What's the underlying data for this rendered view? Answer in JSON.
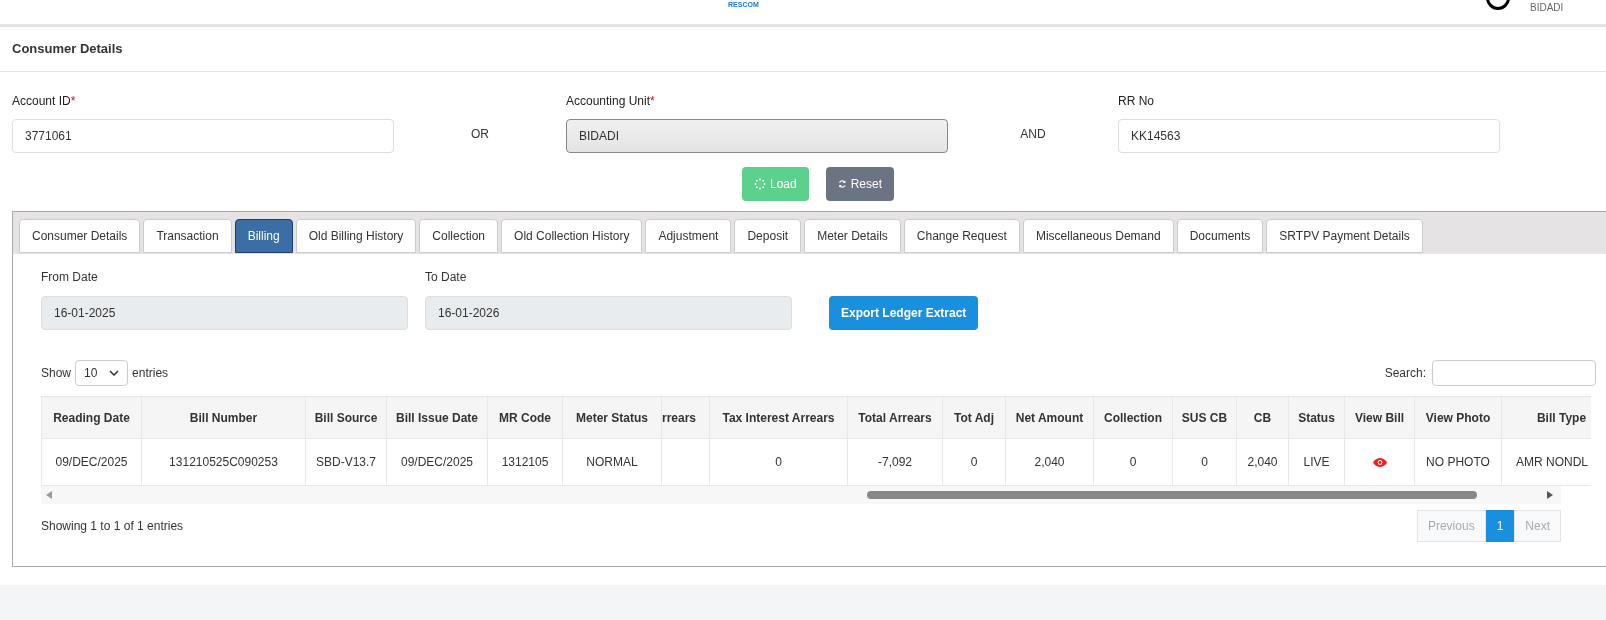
{
  "header": {
    "logo_text": "RESCOM",
    "user": "BIDADI"
  },
  "page_title": "Consumer Details",
  "form": {
    "fields": [
      {
        "label": "Account ID",
        "required_mark": "*",
        "value": "3771061",
        "disabled": false
      },
      {
        "label": "Accounting Unit",
        "required_mark": "*",
        "value": "BIDADI",
        "disabled": true
      },
      {
        "label": "RR No",
        "value": "KK14563",
        "disabled": false
      }
    ],
    "separators": [
      "OR",
      "AND"
    ],
    "buttons": [
      {
        "label": "Load",
        "kind": "load"
      },
      {
        "label": "Reset",
        "kind": "reset"
      }
    ]
  },
  "tabs": [
    {
      "label": "Consumer Details",
      "selected": false
    },
    {
      "label": "Transaction",
      "selected": false
    },
    {
      "label": "Billing",
      "selected": true
    },
    {
      "label": "Old Billing History",
      "selected": false
    },
    {
      "label": "Collection",
      "selected": false
    },
    {
      "label": "Old Collection History",
      "selected": false
    },
    {
      "label": "Adjustment",
      "selected": false
    },
    {
      "label": "Deposit",
      "selected": false
    },
    {
      "label": "Meter Details",
      "selected": false
    },
    {
      "label": "Change Request",
      "selected": false
    },
    {
      "label": "Miscellaneous Demand",
      "selected": false
    },
    {
      "label": "Documents",
      "selected": false
    },
    {
      "label": "SRTPV Payment Details",
      "selected": false
    }
  ],
  "date_range": {
    "fields": [
      {
        "label": "From Date",
        "value": "16-01-2025"
      },
      {
        "label": "To Date",
        "value": "16-01-2026"
      }
    ],
    "export_button": "Export Ledger Extract"
  },
  "table_controls": {
    "show_label": "Show",
    "page_size": "10",
    "entries_label": "entries",
    "search_label": "Search:"
  },
  "table": {
    "columns": [
      "Reading Date",
      "Bill Number",
      "Bill Source",
      "Bill Issue Date",
      "MR Code",
      "Meter Status",
      "rrears",
      "Tax Interest Arrears",
      "Total Arrears",
      "Tot Adj",
      "Net Amount",
      "Collection",
      "SUS CB",
      "CB",
      "Status",
      "View Bill",
      "View Photo",
      "Bill Type"
    ],
    "rows": [
      {
        "cells": [
          {
            "kind": "text",
            "text": "09/DEC/2025"
          },
          {
            "kind": "text",
            "text": "131210525C090253"
          },
          {
            "kind": "text",
            "text": "SBD-V13.7"
          },
          {
            "kind": "text",
            "text": "09/DEC/2025"
          },
          {
            "kind": "text",
            "text": "1312105"
          },
          {
            "kind": "text",
            "text": "NORMAL"
          },
          {
            "kind": "blank"
          },
          {
            "kind": "text",
            "text": "0"
          },
          {
            "kind": "text",
            "text": "-7,092"
          },
          {
            "kind": "text",
            "text": "0"
          },
          {
            "kind": "text",
            "text": "2,040"
          },
          {
            "kind": "text",
            "text": "0"
          },
          {
            "kind": "text",
            "text": "0"
          },
          {
            "kind": "text",
            "text": "2,040"
          },
          {
            "kind": "text",
            "text": "LIVE"
          },
          {
            "kind": "eye"
          },
          {
            "kind": "text",
            "text": "NO PHOTO"
          },
          {
            "kind": "text",
            "text": "AMR NONDL"
          }
        ]
      }
    ]
  },
  "info": "Showing 1 to 1 of 1 entries",
  "pagination": [
    {
      "label": "Previous",
      "disabled": true,
      "selected": false
    },
    {
      "label": "1",
      "disabled": false,
      "selected": true
    },
    {
      "label": "Next",
      "disabled": true,
      "selected": false
    }
  ]
}
